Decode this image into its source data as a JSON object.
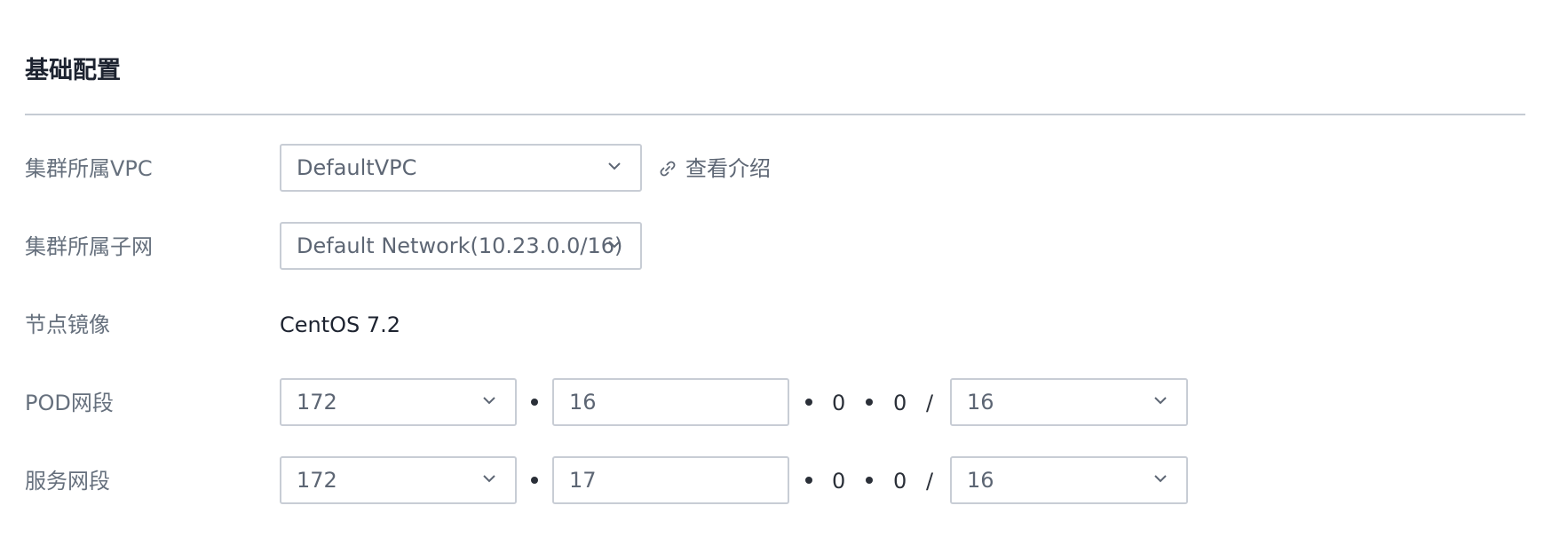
{
  "section": {
    "title": "基础配置"
  },
  "vpc": {
    "label": "集群所属VPC",
    "selected": "DefaultVPC",
    "link_text": "查看介绍"
  },
  "subnet": {
    "label": "集群所属子网",
    "selected": "Default Network(10.23.0.0/16)"
  },
  "image": {
    "label": "节点镜像",
    "value": "CentOS 7.2"
  },
  "pod_cidr": {
    "label": "POD网段",
    "octet1": "172",
    "octet2": "16",
    "octet3": "0",
    "octet4": "0",
    "slash": "/",
    "mask": "16"
  },
  "service_cidr": {
    "label": "服务网段",
    "octet1": "172",
    "octet2": "17",
    "octet3": "0",
    "octet4": "0",
    "slash": "/",
    "mask": "16"
  },
  "icons": {
    "chevron": "chevron-down-icon",
    "link": "link-icon"
  },
  "colors": {
    "label_text": "#66707d",
    "border": "#c8cdd5",
    "title": "#1d2330"
  }
}
